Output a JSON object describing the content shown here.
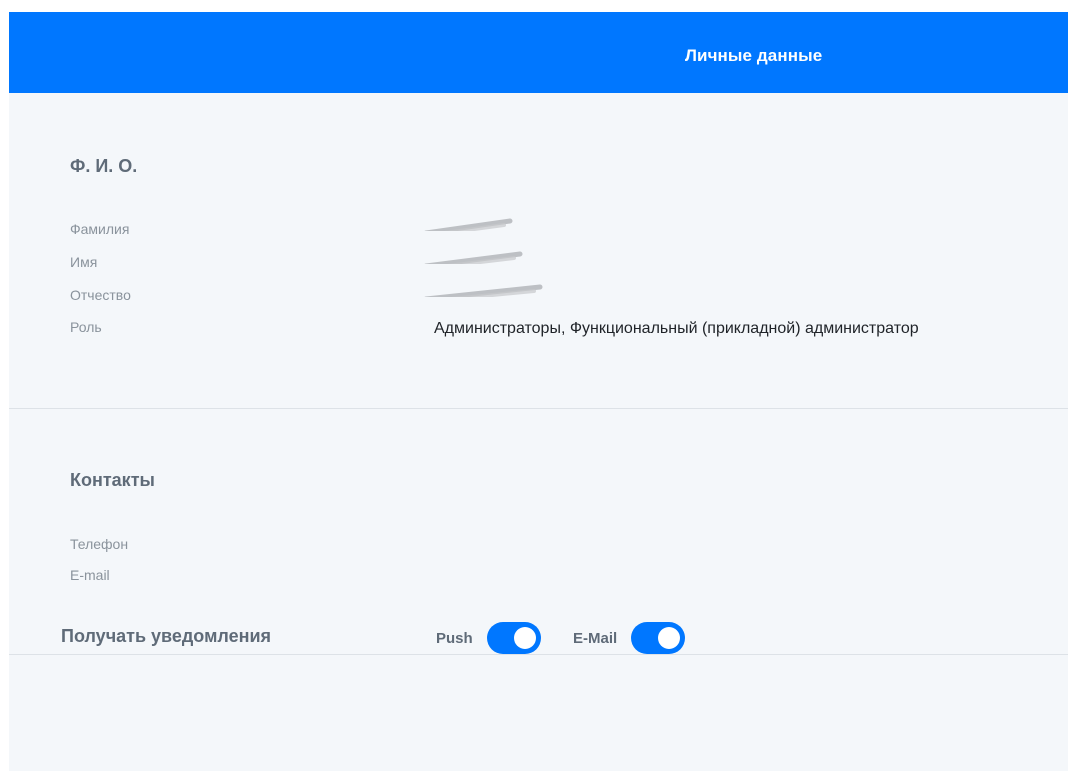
{
  "header": {
    "title": "Личные данные"
  },
  "sections": {
    "fio": {
      "title": "Ф. И. О.",
      "fields": {
        "surname": {
          "label": "Фамилия"
        },
        "name": {
          "label": "Имя"
        },
        "patronymic": {
          "label": "Отчество"
        },
        "role": {
          "label": "Роль",
          "value": "Администраторы, Функциональный (прикладной) администратор"
        }
      }
    },
    "contacts": {
      "title": "Контакты",
      "fields": {
        "phone": {
          "label": "Телефон"
        },
        "email": {
          "label": "E-mail"
        }
      }
    },
    "notifications": {
      "title": "Получать уведомления",
      "push": {
        "label": "Push",
        "on": true
      },
      "email": {
        "label": "E-Mail",
        "on": true
      }
    }
  },
  "colors": {
    "accent": "#0077ff",
    "background": "#f4f7fa",
    "divider": "#dde2e7"
  }
}
